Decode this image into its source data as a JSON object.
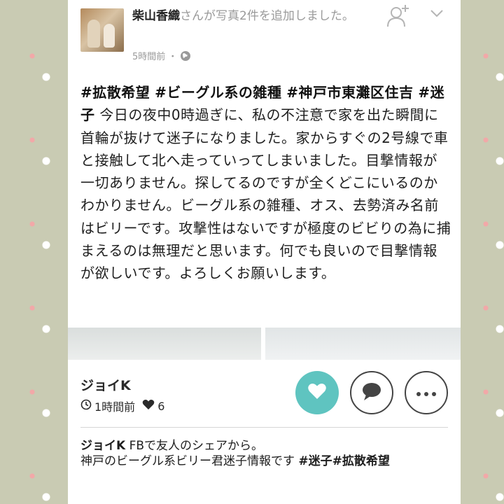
{
  "header": {
    "author_name": "柴山香織",
    "action_text": "さんが写真2件を追加しました。",
    "timestamp": "5時間前",
    "separator": "・",
    "privacy_icon": "globe-icon",
    "add_friend_icon": "add-friend-icon",
    "menu_icon": "chevron-down-icon"
  },
  "post": {
    "tags": [
      "#拡散希望",
      "#ビーグル系の雑種",
      "#神戸市東灘区住吉",
      "#迷子"
    ],
    "text": "今日の夜中0時過ぎに、私の不注意で家を出た瞬間に首輪が抜けて迷子になりました。家からすぐの2号線で車と接触して北へ走っていってしまいました。目撃情報が一切ありません。探してるのですが全くどこにいるのかわかりません。ビーグル系の雑種、オス、去勢済み名前はビリーです。攻撃性はないですが極度のビビりの為に捕まえるのは無理だと思います。何でも良いので目撃情報が欲しいです。よろしくお願いします。",
    "photo_count": 2
  },
  "sharer": {
    "name": "ジョイK",
    "time": "1時間前",
    "likes": "6",
    "clock_icon": "clock-icon",
    "heart_icon": "heart-icon"
  },
  "actions": {
    "like_icon": "heart-icon",
    "comment_icon": "speech-bubble-icon",
    "more_icon": "more-icon"
  },
  "comment": {
    "author": "ジョイK",
    "line1": " FBで友人のシェアから。",
    "line2": "神戸のビーグル系ビリー君迷子情報です ",
    "tag1": "#迷子",
    "tag2": "#拡散希望"
  },
  "colors": {
    "accent": "#5fc4c0",
    "background": "#c9cbb3",
    "card": "#ffffff"
  }
}
